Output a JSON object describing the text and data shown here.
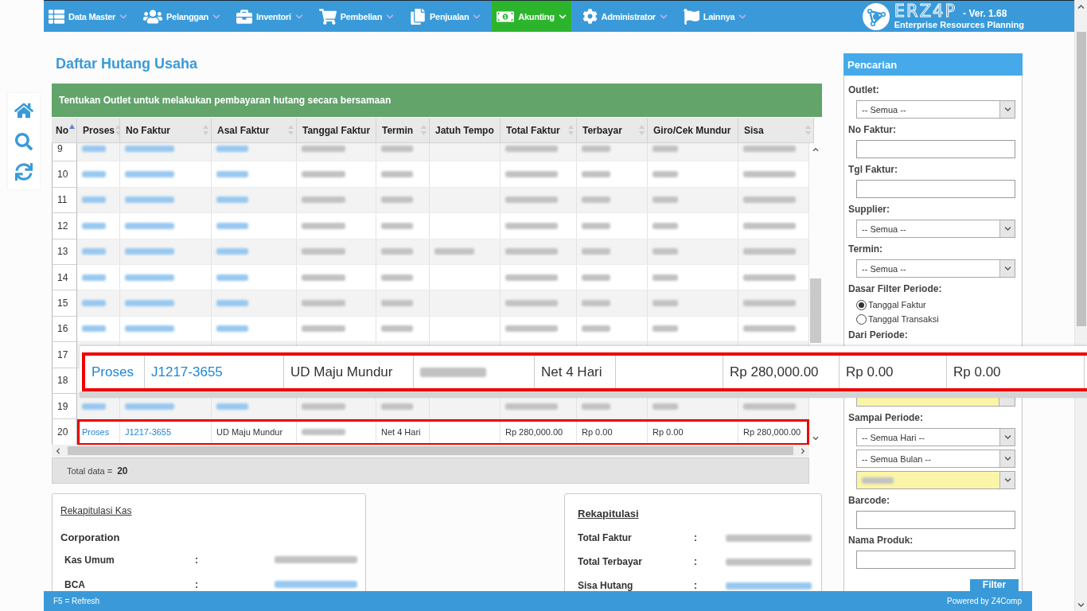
{
  "nav": {
    "items": [
      {
        "label": "Data Master",
        "selected": false
      },
      {
        "label": "Pelanggan",
        "selected": false
      },
      {
        "label": "Inventori",
        "selected": false
      },
      {
        "label": "Pembelian",
        "selected": false
      },
      {
        "label": "Penjualan",
        "selected": false
      },
      {
        "label": "Akunting",
        "selected": true
      },
      {
        "label": "Administrator",
        "selected": false
      },
      {
        "label": "Lainnya",
        "selected": false
      }
    ]
  },
  "logo": {
    "wordmark": "ERZ4P",
    "version": "- Ver. 1.68",
    "tagline": "Enterprise Resources Planning"
  },
  "page_title": "Daftar Hutang Usaha",
  "banner": "Tentukan Outlet untuk melakukan pembayaran hutang secara bersamaan",
  "table": {
    "columns": [
      {
        "label": "No",
        "sorted": true
      },
      {
        "label": "Proses",
        "sortable": true,
        "sorted": false
      },
      {
        "label": "No Faktur",
        "sortable": true,
        "sorted": false
      },
      {
        "label": "Asal Faktur",
        "sortable": true,
        "sorted": false
      },
      {
        "label": "Tanggal Faktur",
        "sortable": false,
        "sorted": false
      },
      {
        "label": "Termin",
        "sortable": true,
        "sorted": false
      },
      {
        "label": "Jatuh Tempo",
        "sortable": false,
        "sorted": false
      },
      {
        "label": "Total Faktur",
        "sortable": true,
        "sorted": false
      },
      {
        "label": "Terbayar",
        "sortable": true,
        "sorted": false
      },
      {
        "label": "Giro/Cek Mundur",
        "sortable": false,
        "sorted": false
      },
      {
        "label": "Sisa",
        "sortable": true,
        "sorted": false
      }
    ],
    "rows": [
      {
        "no": "9",
        "highlighted": false,
        "cells": [
          {
            "link": true,
            "redacted": true
          },
          {
            "link": true,
            "redacted": true
          },
          {
            "link": true,
            "redacted": true
          },
          {
            "redacted": true
          },
          {
            "redacted": true
          },
          {
            "redacted": false
          },
          {
            "redacted": true
          },
          {
            "redacted": true
          },
          {
            "redacted": true
          },
          {
            "redacted": true
          }
        ]
      },
      {
        "no": "10",
        "highlighted": false,
        "cells": [
          {
            "link": true,
            "redacted": true
          },
          {
            "link": true,
            "redacted": true
          },
          {
            "link": true,
            "redacted": true
          },
          {
            "redacted": true
          },
          {
            "redacted": true
          },
          {
            "redacted": false
          },
          {
            "redacted": true
          },
          {
            "redacted": true
          },
          {
            "redacted": true
          },
          {
            "redacted": true
          }
        ]
      },
      {
        "no": "11",
        "highlighted": false,
        "cells": [
          {
            "link": true,
            "redacted": true
          },
          {
            "link": true,
            "redacted": true
          },
          {
            "link": true,
            "redacted": true
          },
          {
            "redacted": true
          },
          {
            "redacted": true
          },
          {
            "redacted": false
          },
          {
            "redacted": true
          },
          {
            "redacted": true
          },
          {
            "redacted": true
          },
          {
            "redacted": true
          }
        ]
      },
      {
        "no": "12",
        "highlighted": false,
        "cells": [
          {
            "link": true,
            "redacted": true
          },
          {
            "link": true,
            "redacted": true
          },
          {
            "link": true,
            "redacted": true
          },
          {
            "redacted": true
          },
          {
            "redacted": true
          },
          {
            "redacted": false
          },
          {
            "redacted": true
          },
          {
            "redacted": true
          },
          {
            "redacted": true
          },
          {
            "redacted": true
          }
        ]
      },
      {
        "no": "13",
        "highlighted": false,
        "cells": [
          {
            "link": true,
            "redacted": true
          },
          {
            "link": true,
            "redacted": true
          },
          {
            "link": true,
            "redacted": true
          },
          {
            "redacted": true
          },
          {
            "redacted": true
          },
          {
            "redacted": true
          },
          {
            "redacted": true
          },
          {
            "redacted": true
          },
          {
            "redacted": true
          },
          {
            "redacted": true
          }
        ]
      },
      {
        "no": "14",
        "highlighted": false,
        "cells": [
          {
            "link": true,
            "redacted": true
          },
          {
            "link": true,
            "redacted": true
          },
          {
            "link": true,
            "redacted": true
          },
          {
            "redacted": true
          },
          {
            "redacted": true
          },
          {
            "redacted": false
          },
          {
            "redacted": true
          },
          {
            "redacted": true
          },
          {
            "redacted": true
          },
          {
            "redacted": true
          }
        ]
      },
      {
        "no": "15",
        "highlighted": false,
        "cells": [
          {
            "link": true,
            "redacted": true
          },
          {
            "link": true,
            "redacted": true
          },
          {
            "link": true,
            "redacted": true
          },
          {
            "redacted": true
          },
          {
            "redacted": true
          },
          {
            "redacted": false
          },
          {
            "redacted": true
          },
          {
            "redacted": true
          },
          {
            "redacted": true
          },
          {
            "redacted": true
          }
        ]
      },
      {
        "no": "16",
        "highlighted": false,
        "cells": [
          {
            "link": true,
            "redacted": true
          },
          {
            "link": true,
            "redacted": true
          },
          {
            "link": true,
            "redacted": true
          },
          {
            "redacted": true
          },
          {
            "redacted": true
          },
          {
            "redacted": false
          },
          {
            "redacted": true
          },
          {
            "redacted": true
          },
          {
            "redacted": true
          },
          {
            "redacted": true
          }
        ]
      },
      {
        "no": "17",
        "highlighted": false
      },
      {
        "no": "18",
        "highlighted": false
      },
      {
        "no": "19",
        "highlighted": false,
        "cells": [
          {
            "link": true,
            "redacted": true
          },
          {
            "link": true,
            "redacted": true
          },
          {
            "link": true,
            "redacted": true
          },
          {
            "redacted": true
          },
          {
            "redacted": true
          },
          {
            "redacted": false
          },
          {
            "redacted": true
          },
          {
            "redacted": true
          },
          {
            "redacted": true
          },
          {
            "redacted": true
          }
        ]
      },
      {
        "no": "20",
        "highlighted": true,
        "cells": [
          {
            "link": true,
            "text": "Proses"
          },
          {
            "link": true,
            "text": "J1217-3655"
          },
          {
            "text": "UD Maju Mundur"
          },
          {
            "redacted": true
          },
          {
            "text": "Net 4 Hari"
          },
          {
            "redacted": false
          },
          {
            "text": "Rp 280,000.00"
          },
          {
            "text": "Rp 0.00"
          },
          {
            "text": "Rp 0.00"
          },
          {
            "text": "Rp 280,000.00"
          }
        ]
      }
    ]
  },
  "total": {
    "label": "Total data =",
    "value": "20"
  },
  "magnifier": {
    "highlighted": true,
    "cells": [
      {
        "link": true,
        "text": "Proses"
      },
      {
        "link": true,
        "text": "J1217-3655"
      },
      {
        "text": "UD Maju Mundur"
      },
      {
        "redacted": true
      },
      {
        "text": "Net 4 Hari"
      },
      {
        "redacted": false
      },
      {
        "text": "Rp 280,000.00"
      },
      {
        "text": "Rp 0.00"
      },
      {
        "text": "Rp 0.00"
      }
    ]
  },
  "cash_summary": {
    "title": "Rekapitulasi Kas",
    "group": "Corporation",
    "rows": [
      {
        "label": "Kas Umum",
        "separator": ":",
        "redacted": true,
        "link": false
      },
      {
        "label": "BCA",
        "separator": ":",
        "redacted": true,
        "link": true
      }
    ]
  },
  "summary": {
    "title": "Rekapitulasi",
    "rows": [
      {
        "label": "Total Faktur",
        "separator": ":",
        "redacted": true,
        "link": false
      },
      {
        "label": "Total Terbayar",
        "separator": ":",
        "redacted": true,
        "link": false
      },
      {
        "label": "Sisa Hutang",
        "separator": ":",
        "redacted": true,
        "link": true
      }
    ]
  },
  "search_panel": {
    "title": "Pencarian",
    "fields": [
      {
        "kind": "select",
        "label": "Outlet:",
        "selects": [
          {
            "value": "-- Semua --",
            "changed": false
          }
        ]
      },
      {
        "kind": "input",
        "label": "No Faktur:"
      },
      {
        "kind": "input",
        "label": "Tgl Faktur:"
      },
      {
        "kind": "select",
        "label": "Supplier:",
        "selects": [
          {
            "value": "-- Semua --",
            "changed": false
          }
        ]
      },
      {
        "kind": "select",
        "label": "Termin:",
        "selects": [
          {
            "value": "-- Semua --",
            "changed": false
          }
        ]
      },
      {
        "kind": "radio",
        "label": "Dasar Filter Periode:",
        "options": [
          {
            "label": "Tanggal Faktur",
            "selected": true
          },
          {
            "label": "Tanggal Transaksi",
            "selected": false
          }
        ]
      },
      {
        "kind": "select",
        "label": "Dari Periode:",
        "selects": [
          {
            "changed": true,
            "clipped": true
          }
        ]
      },
      {
        "kind": "select",
        "label": "Sampai Periode:",
        "selects": [
          {
            "value": "-- Semua Hari --",
            "changed": false
          },
          {
            "value": "-- Semua Bulan --",
            "changed": false
          },
          {
            "redacted": true,
            "changed": true
          }
        ]
      },
      {
        "kind": "input",
        "label": "Barcode:"
      },
      {
        "kind": "input",
        "label": "Nama Produk:"
      }
    ],
    "button": "Filter"
  },
  "status_bar": {
    "hint": "F5 = Refresh",
    "credit": "Powered by Z4Comp"
  }
}
